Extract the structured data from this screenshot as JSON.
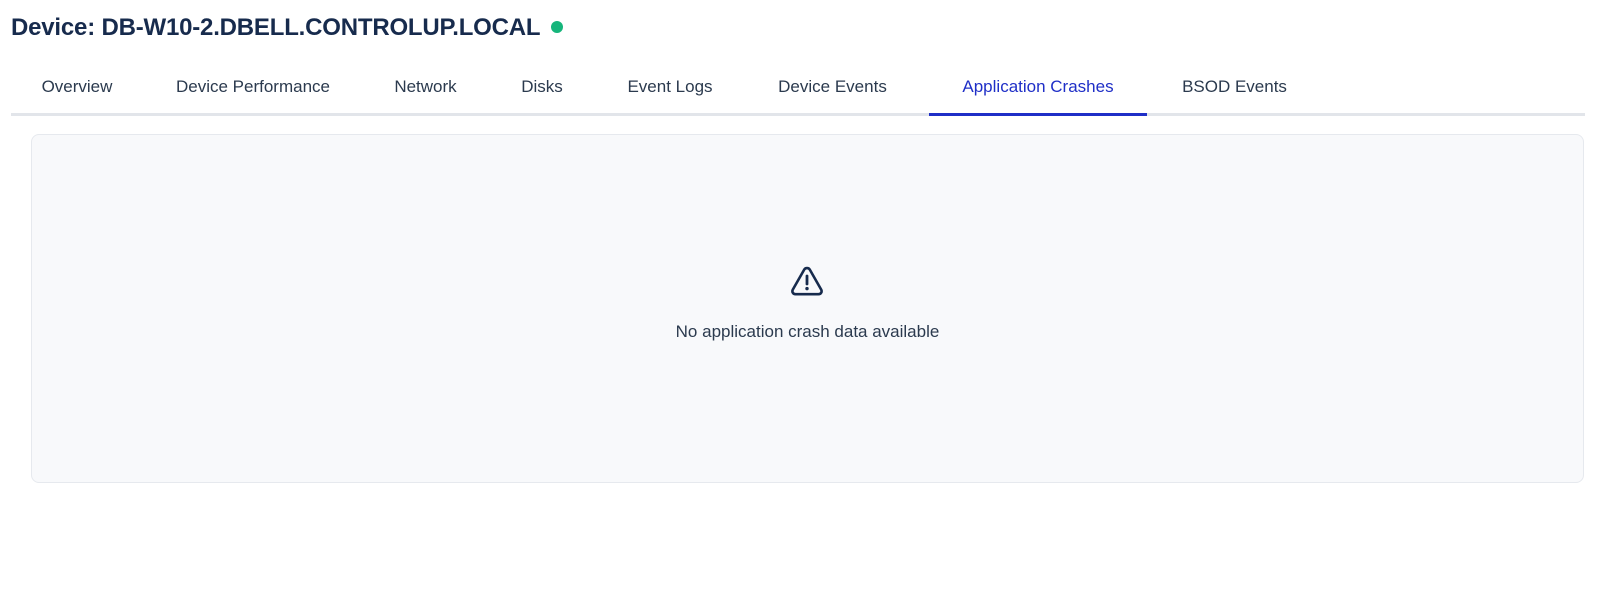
{
  "header": {
    "title": "Device: DB-W10-2.DBELL.CONTROLUP.LOCAL",
    "status_color": "#16b57b",
    "status": "online"
  },
  "tabs": [
    {
      "label": "Overview",
      "active": false
    },
    {
      "label": "Device Performance",
      "active": false
    },
    {
      "label": "Network",
      "active": false
    },
    {
      "label": "Disks",
      "active": false
    },
    {
      "label": "Event Logs",
      "active": false
    },
    {
      "label": "Device Events",
      "active": false
    },
    {
      "label": "Application Crashes",
      "active": true
    },
    {
      "label": "BSOD Events",
      "active": false
    }
  ],
  "empty_state": {
    "icon": "warning-triangle-icon",
    "message": "No application crash data available"
  },
  "colors": {
    "accent": "#1f2fc7",
    "text": "#172b4d",
    "panel_bg": "#f8f9fb"
  }
}
